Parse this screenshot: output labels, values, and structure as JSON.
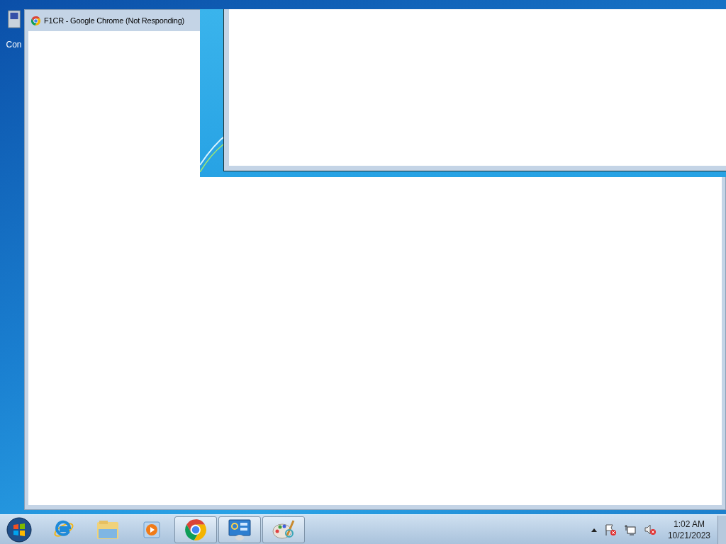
{
  "desktop": {
    "icons": [
      {
        "label": "Con"
      }
    ]
  },
  "windows": [
    {
      "title": "F1CR - Google Chrome (Not Responding)"
    }
  ],
  "taskbar": {
    "items": [
      {
        "running": false
      },
      {
        "running": false
      },
      {
        "running": false
      },
      {
        "running": true
      },
      {
        "running": true
      },
      {
        "running": true
      }
    ],
    "clock": {
      "time": "1:02 AM",
      "date": "10/21/2023"
    }
  }
}
